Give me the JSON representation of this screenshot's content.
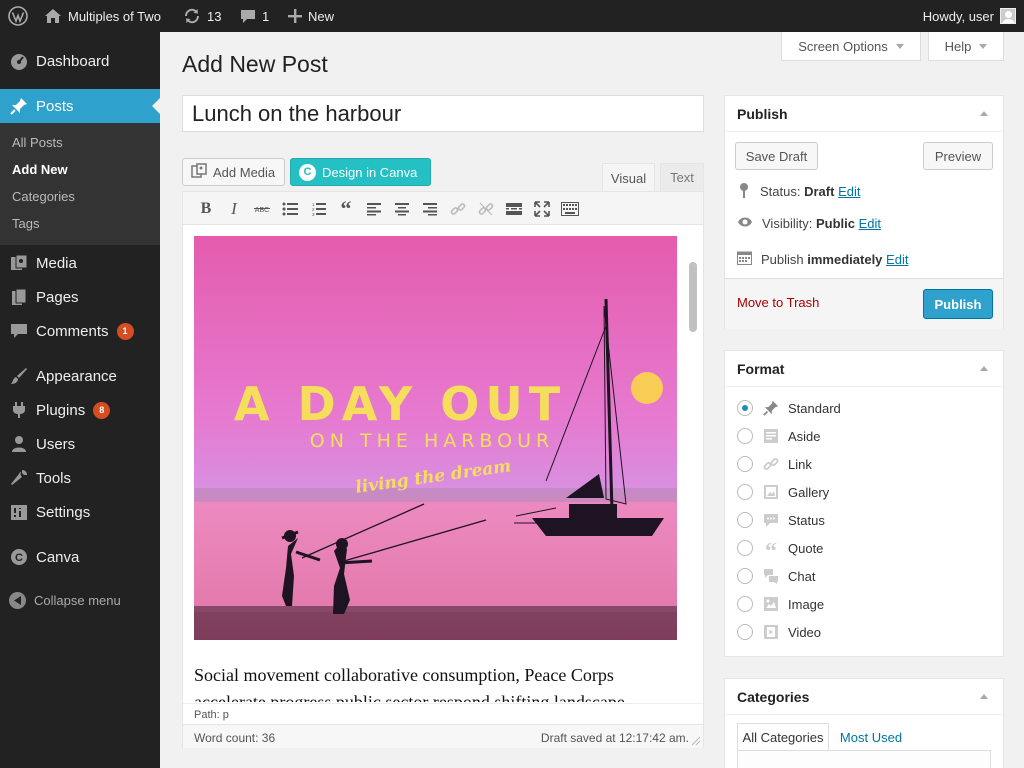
{
  "adminbar": {
    "site_name": "Multiples of Two",
    "updates_count": "13",
    "comments_count": "1",
    "new_label": "New",
    "greeting": "Howdy, user"
  },
  "sidebar": {
    "items": [
      {
        "label": "Dashboard",
        "icon": "dashboard-icon"
      },
      {
        "label": "Posts",
        "icon": "pin-icon"
      },
      {
        "label": "Media",
        "icon": "media-icon"
      },
      {
        "label": "Pages",
        "icon": "pages-icon"
      },
      {
        "label": "Comments",
        "icon": "comment-icon",
        "badge": "1"
      },
      {
        "label": "Appearance",
        "icon": "paintbrush-icon"
      },
      {
        "label": "Plugins",
        "icon": "plug-icon",
        "badge": "8"
      },
      {
        "label": "Users",
        "icon": "users-icon"
      },
      {
        "label": "Tools",
        "icon": "wrench-icon"
      },
      {
        "label": "Settings",
        "icon": "settings-icon"
      },
      {
        "label": "Canva",
        "icon": "canva-icon"
      }
    ],
    "submenu": [
      "All Posts",
      "Add New",
      "Categories",
      "Tags"
    ],
    "collapse_label": "Collapse menu"
  },
  "screen_options_label": "Screen Options",
  "help_label": "Help",
  "page_title": "Add New Post",
  "post_title": "Lunch on the harbour",
  "media_buttons": {
    "add_media": "Add Media",
    "canva": "Design in Canva"
  },
  "editor_tabs": {
    "visual": "Visual",
    "text": "Text"
  },
  "hero": {
    "line1": "A DAY OUT",
    "line2": "ON THE HARBOUR",
    "line3": "living the dream"
  },
  "content_text": "Social movement collaborative consumption, Peace Corps accelerate progress public sector respond shifting landscape",
  "path_label": "Path: p",
  "word_count": "Word count: 36",
  "draft_saved": "Draft saved at 12:17:42 am.",
  "publish_box": {
    "title": "Publish",
    "save_draft": "Save Draft",
    "preview": "Preview",
    "status_label": "Status:",
    "status_value": "Draft",
    "visibility_label": "Visibility:",
    "visibility_value": "Public",
    "publish_label": "Publish",
    "publish_value": "immediately",
    "edit": "Edit",
    "trash": "Move to Trash",
    "publish_button": "Publish"
  },
  "format_box": {
    "title": "Format",
    "options": [
      {
        "label": "Standard",
        "icon": "pin-icon",
        "checked": true
      },
      {
        "label": "Aside",
        "icon": "aside-icon"
      },
      {
        "label": "Link",
        "icon": "link-icon"
      },
      {
        "label": "Gallery",
        "icon": "gallery-icon"
      },
      {
        "label": "Status",
        "icon": "status-icon"
      },
      {
        "label": "Quote",
        "icon": "quote-icon"
      },
      {
        "label": "Chat",
        "icon": "chat-icon"
      },
      {
        "label": "Image",
        "icon": "image-icon"
      },
      {
        "label": "Video",
        "icon": "video-icon"
      }
    ]
  },
  "categories_box": {
    "title": "Categories",
    "tab_all": "All Categories",
    "tab_most_used": "Most Used"
  },
  "colors": {
    "admin_dark": "#222222",
    "accent_blue": "#2ea2cc",
    "canva_teal": "#24c0c4",
    "badge_orange": "#d54e21",
    "trash_red": "#aa0000",
    "hero_yellow": "#f5de5c"
  }
}
